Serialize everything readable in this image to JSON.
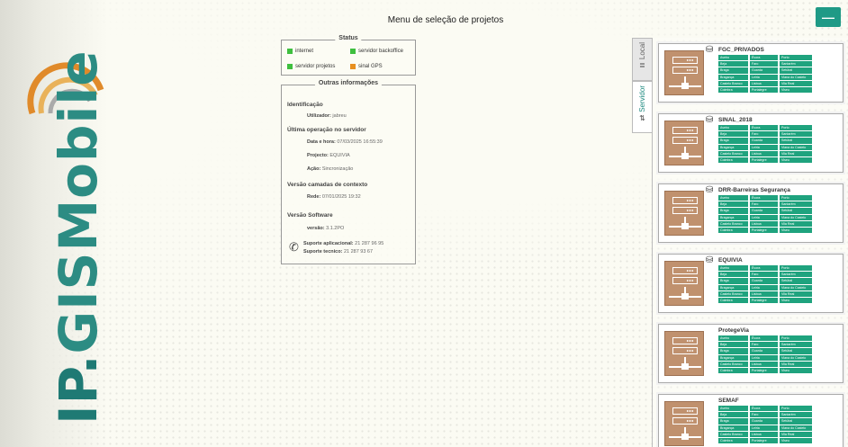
{
  "window": {
    "title": "Menu de seleção de projetos",
    "minimize_label": "—"
  },
  "brand": {
    "part1": "IP",
    "part2": ".",
    "part3": "GIS",
    "part4": "Mobile"
  },
  "status": {
    "legend": "Status",
    "items": [
      {
        "label": "internet",
        "color": "#3fbf3f"
      },
      {
        "label": "servidor backoffice",
        "color": "#3fbf3f"
      },
      {
        "label": "servidor projetos",
        "color": "#3fbf3f"
      },
      {
        "label": "sinal GPS",
        "color": "#e89020"
      }
    ]
  },
  "info": {
    "legend": "Outras informações",
    "identificacao_title": "Identificação",
    "utilizador_label": "Utilizador:",
    "utilizador_value": "jabreu",
    "ultima_op_title": "Última operação no servidor",
    "data_hora_label": "Data e hora:",
    "data_hora_value": "07/03/2025 16:55:39",
    "projecto_label": "Projecto:",
    "projecto_value": "EQUIVIA",
    "accao_label": "Ação:",
    "accao_value": "Sincronização",
    "versao_camadas_title": "Versão camadas de contexto",
    "rede_label": "Rede:",
    "rede_value": "07/01/2025 19:32",
    "versao_software_title": "Versão Software",
    "versao_label": "versão:",
    "versao_value": "3.1.2PO",
    "suporte_app_label": "Suporte aplicacional:",
    "suporte_app_value": "21 287 96 95",
    "suporte_tec_label": "Suporte tecnico:",
    "suporte_tec_value": "21 287 93 67"
  },
  "tabs": {
    "local": "Local",
    "servidor": "Servidor"
  },
  "districts": [
    "Aveiro",
    "Évora",
    "Porto",
    "Beja",
    "Faro",
    "Santarém",
    "Braga",
    "Guarda",
    "Setúbal",
    "Bragança",
    "Leiria",
    "Viana do Castelo",
    "Castelo Branco",
    "Lisboa",
    "Vila Real",
    "Coimbra",
    "Portalegre",
    "Viseu"
  ],
  "projects": [
    {
      "name": "FGC_PRIVADOS",
      "has_db": true
    },
    {
      "name": "SINAL_2018",
      "has_db": true
    },
    {
      "name": "DRR-Barreiras Segurança",
      "has_db": true
    },
    {
      "name": "EQUIVIA",
      "has_db": true
    },
    {
      "name": "ProtegeVia",
      "has_db": false
    },
    {
      "name": "SEMAF",
      "has_db": false
    }
  ]
}
